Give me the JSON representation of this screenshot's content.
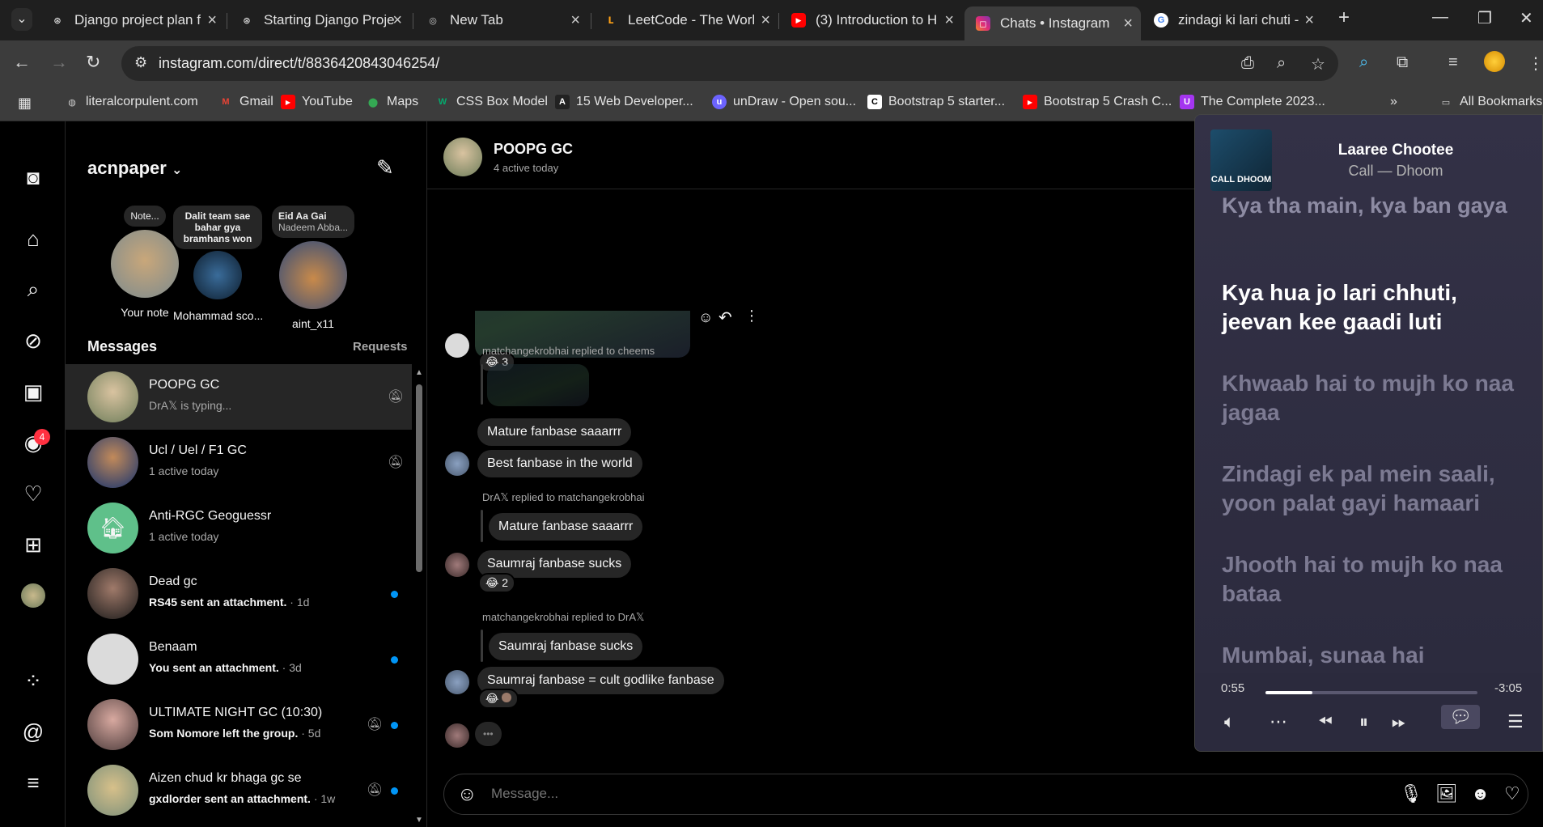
{
  "browser": {
    "tabs": [
      {
        "title": "Django project plan f",
        "favicon": "chatgpt-icon"
      },
      {
        "title": "Starting Django Proje",
        "favicon": "chatgpt-icon"
      },
      {
        "title": "New Tab",
        "favicon": "chrome-icon"
      },
      {
        "title": "LeetCode - The Worl",
        "favicon": "leetcode-icon"
      },
      {
        "title": "(3) Introduction to H",
        "favicon": "youtube-icon"
      },
      {
        "title": "Chats • Instagram",
        "favicon": "instagram-icon"
      },
      {
        "title": "zindagi ki lari chuti -",
        "favicon": "google-icon"
      }
    ],
    "url": "instagram.com/direct/t/8836420843046254/",
    "bookmarks": [
      "literalcorpulent.com",
      "Gmail",
      "YouTube",
      "Maps",
      "CSS Box Model",
      "15 Web Developer...",
      "unDraw - Open sou...",
      "Bootstrap 5 starter...",
      "Bootstrap 5 Crash C...",
      "The Complete 2023..."
    ],
    "all_bookmarks": "All Bookmarks"
  },
  "sidebar": {
    "notification_count": "4"
  },
  "inbox": {
    "username": "acnpaper",
    "notes": [
      {
        "text": "Note...",
        "name": "Your note"
      },
      {
        "text": "Dalit team sae bahar gya bramhans won",
        "name": "Mohammad sco..."
      },
      {
        "text": "Eid Aa Gai",
        "sub": "Nadeem Abba...",
        "name": "aint_x11"
      }
    ],
    "messages_heading": "Messages",
    "requests_label": "Requests",
    "threads": [
      {
        "name": "POOPG GC",
        "sub": "DrA𝕏 is typing...",
        "muted": true
      },
      {
        "name": "Ucl / Uel / F1 GC",
        "sub": "1 active today",
        "muted": true
      },
      {
        "name": "Anti-RGC Geoguessr",
        "sub": "1 active today"
      },
      {
        "name": "Dead gc",
        "sub_bold": "RS45 sent an attachment.",
        "time": " · 1d",
        "unread": true
      },
      {
        "name": "Benaam",
        "sub_bold": "You sent an attachment.",
        "time": " · 3d",
        "unread": true
      },
      {
        "name": "ULTIMATE NIGHT GC (10:30)",
        "sub_bold": "Som Nomore left the group.",
        "time": " · 5d",
        "muted": true,
        "unread": true
      },
      {
        "name": "Aizen chud kr bhaga gc se",
        "sub_bold": "gxdlorder sent an attachment.",
        "time": " · 1w",
        "muted": true,
        "unread": true
      }
    ]
  },
  "chat": {
    "name": "POOPG GC",
    "status": "4 active today",
    "reaction1": "😂 3",
    "reply1": "matchangekrobhai replied to cheems",
    "m1": "Mature fanbase saaarrr",
    "m2": "Best fanbase in the world",
    "reply2": "DrA𝕏 replied to matchangekrobhai",
    "quoted2": "Mature fanbase saaarrr",
    "m3": "Saumraj fanbase sucks",
    "reaction2": "😂 2",
    "reply3": "matchangekrobhai replied to DrA𝕏",
    "quoted3": "Saumraj fanbase sucks",
    "m4": "Saumraj fanbase = cult godlike fanbase",
    "reaction3": "😂",
    "typing": "•••",
    "input_placeholder": "Message..."
  },
  "player": {
    "track": "Laaree Chootee",
    "artist": "Call — Dhoom",
    "cover_text": "CALL DHOOM",
    "lyrics": [
      "Kya tha main, kya ban gaya",
      "Kya hua jo lari chhuti, jeevan kee gaadi luti",
      "Khwaab hai to mujh ko naa jagaa",
      "Zindagi ek pal mein saali, yoon palat gayi hamaari",
      "Jhooth hai to mujh ko naa bataa",
      "Mumbai, sunaa hai"
    ],
    "elapsed": "0:55",
    "remaining": "-3:05",
    "progress": 0.22
  }
}
